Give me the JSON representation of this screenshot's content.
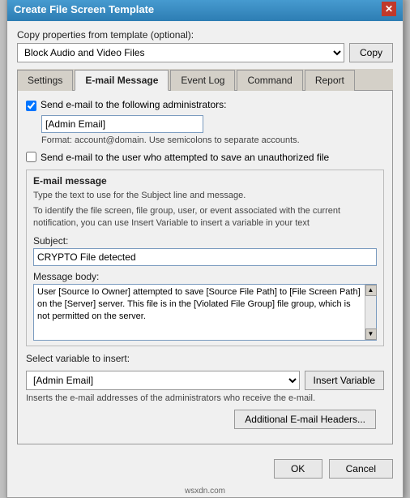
{
  "dialog": {
    "title": "Create File Screen Template",
    "close_label": "✕"
  },
  "copy_section": {
    "label": "Copy properties from template (optional):",
    "selected_value": "Block Audio and Video Files",
    "copy_button": "Copy"
  },
  "tabs": [
    {
      "id": "settings",
      "label": "Settings",
      "active": false
    },
    {
      "id": "email",
      "label": "E-mail Message",
      "active": true
    },
    {
      "id": "eventlog",
      "label": "Event Log",
      "active": false
    },
    {
      "id": "command",
      "label": "Command",
      "active": false
    },
    {
      "id": "report",
      "label": "Report",
      "active": false
    }
  ],
  "email_tab": {
    "admin_email_checkbox_label": "Send e-mail to the following administrators:",
    "admin_email_checked": true,
    "admin_email_value": "[Admin Email]",
    "format_text": "Format: account@domain. Use semicolons to separate accounts.",
    "unauthorized_checkbox_label": "Send e-mail to the user who attempted to save an unauthorized file",
    "unauthorized_checked": false,
    "group_title": "E-mail message",
    "group_desc1": "Type the text to use for the Subject line and message.",
    "group_desc2": "To identify the file screen, file group, user, or event associated with the current notification, you can use Insert Variable to insert a variable in your text",
    "subject_label": "Subject:",
    "subject_value": "CRYPTO File detected",
    "message_label": "Message body:",
    "message_value": "User [Source Io Owner] attempted to save [Source File Path] to [File Screen Path] on the [Server] server. This file is in the [Violated File Group] file group, which is not permitted on the server.",
    "variable_label": "Select variable to insert:",
    "variable_value": "[Admin Email]",
    "insert_variable_btn": "Insert Variable",
    "variable_desc": "Inserts the e-mail addresses of the administrators who receive the e-mail.",
    "additional_btn": "Additional E-mail Headers..."
  },
  "footer": {
    "ok_label": "OK",
    "cancel_label": "Cancel"
  },
  "watermark": "wsxdn.com"
}
